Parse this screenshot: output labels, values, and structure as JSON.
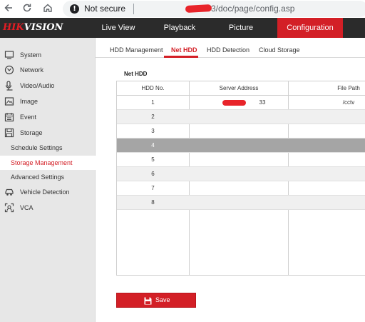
{
  "browser": {
    "security_label": "Not secure",
    "url": "3/doc/page/config.asp"
  },
  "header": {
    "logo_hik": "HIK",
    "logo_vision": "VISION",
    "nav": [
      {
        "label": "Live View",
        "active": false
      },
      {
        "label": "Playback",
        "active": false
      },
      {
        "label": "Picture",
        "active": false
      },
      {
        "label": "Configuration",
        "active": true
      }
    ]
  },
  "sidebar": {
    "items": [
      {
        "label": "System",
        "icon": "monitor-icon"
      },
      {
        "label": "Network",
        "icon": "globe-icon"
      },
      {
        "label": "Video/Audio",
        "icon": "mic-icon"
      },
      {
        "label": "Image",
        "icon": "image-icon"
      },
      {
        "label": "Event",
        "icon": "calendar-icon"
      },
      {
        "label": "Storage",
        "icon": "storage-icon"
      },
      {
        "label": "Schedule Settings",
        "icon": ""
      },
      {
        "label": "Storage Management",
        "icon": "",
        "active": true
      },
      {
        "label": "Advanced Settings",
        "icon": ""
      },
      {
        "label": "Vehicle Detection",
        "icon": "car-icon"
      },
      {
        "label": "VCA",
        "icon": "vca-icon"
      }
    ]
  },
  "tabs": [
    "HDD Management",
    "Net HDD",
    "HDD Detection",
    "Cloud Storage"
  ],
  "active_tab": "Net HDD",
  "section_title": "Net HDD",
  "table": {
    "headers": [
      "HDD No.",
      "Server Address",
      "File Path"
    ],
    "rows": [
      {
        "no": "1",
        "address": "33",
        "path": "/cctv"
      },
      {
        "no": "2",
        "address": "",
        "path": ""
      },
      {
        "no": "3",
        "address": "",
        "path": ""
      },
      {
        "no": "4",
        "address": "",
        "path": ""
      },
      {
        "no": "5",
        "address": "",
        "path": ""
      },
      {
        "no": "6",
        "address": "",
        "path": ""
      },
      {
        "no": "7",
        "address": "",
        "path": ""
      },
      {
        "no": "8",
        "address": "",
        "path": ""
      }
    ]
  },
  "save_label": "Save",
  "colors": {
    "accent": "#d31f26",
    "header_bg": "#2b2b2b",
    "sidebar_bg": "#e7e7e7"
  }
}
